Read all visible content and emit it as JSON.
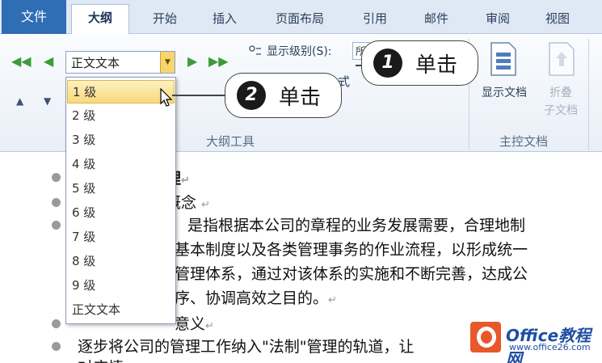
{
  "tabs": [
    "文件",
    "大纲",
    "开始",
    "插入",
    "页面布局",
    "引用",
    "邮件",
    "审阅",
    "视图"
  ],
  "ribbon": {
    "level_combo_value": "正文文本",
    "show_level_label": "显示级别(S):",
    "show_level_value": "所",
    "style_fragment": "式",
    "outline_tools_label": "大纲工具",
    "master_doc_label": "主控文档",
    "show_doc_label": "显示文档",
    "collapse_line1": "折叠",
    "collapse_line2": "子文档"
  },
  "dropdown": {
    "items": [
      "1 级",
      "2 级",
      "3 级",
      "4 级",
      "5 级",
      "6 级",
      "7 级",
      "8 级",
      "9 级",
      "正文文本"
    ],
    "selected": "1 级"
  },
  "callouts": [
    {
      "number": "1",
      "text": "单击"
    },
    {
      "number": "2",
      "text": "单击"
    }
  ],
  "document": {
    "lines": [
      "理",
      "概念",
      "是指根据本公司的章程的业务发展需要，合理地制",
      "基本制度以及各类管理事务的作业流程，以形成统一",
      "管理体系，通过对该体系的实施和不断完善，达成公",
      "序、协调高效之目的。",
      "意义",
      "逐步将公司的管理工作纳入\"法制\"管理的轨道，让",
      "对应情"
    ],
    "para_mark": "↵"
  },
  "watermark": {
    "title": "Office教程网",
    "url": "www.office26.com"
  },
  "colors": {
    "file_tab": "#2f6db5",
    "arrow_green": "#3e9a3a",
    "selection": "#f8d97a",
    "watermark_orange": "#e8582a"
  }
}
